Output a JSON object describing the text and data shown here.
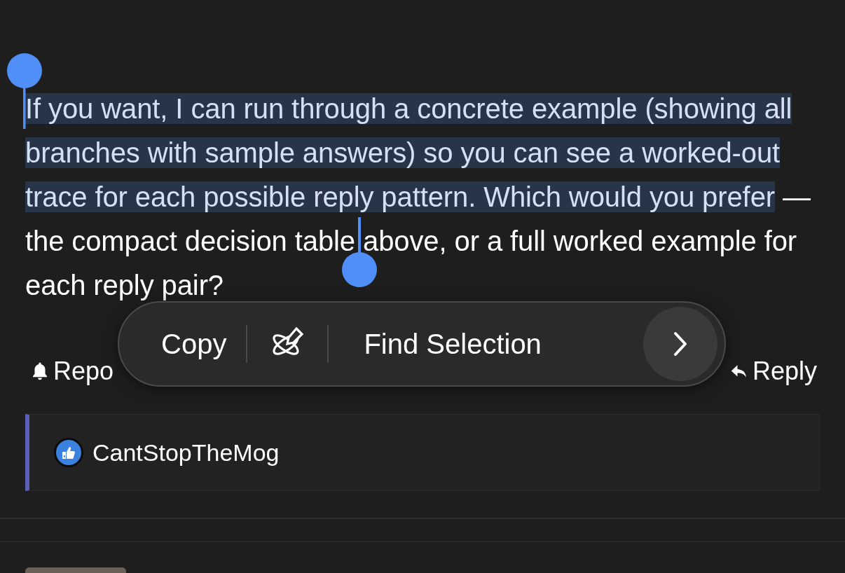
{
  "post": {
    "segments": [
      {
        "text": "If you want, I can run through a concrete example (showing all branches with sample answers) so you can see a worked-out trace for each possible reply pattern. Which would you prefer",
        "selected": true
      },
      {
        "text": " — the compact decision table above, or a full worked example for each reply pair?",
        "selected": false
      }
    ],
    "actions": [
      {
        "kind": "bell",
        "label": "Repo"
      },
      {
        "kind": "reply",
        "label": "Reply"
      }
    ]
  },
  "reaction": {
    "kind": "like",
    "user": "CantStopTheMog"
  },
  "context_menu": {
    "items": [
      {
        "kind": "text",
        "label": "Copy"
      },
      {
        "kind": "divider"
      },
      {
        "kind": "icon"
      },
      {
        "kind": "divider"
      },
      {
        "kind": "text",
        "label": "Find Selection"
      },
      {
        "kind": "more"
      }
    ]
  },
  "next_post": {
    "kind": "avatar"
  }
}
